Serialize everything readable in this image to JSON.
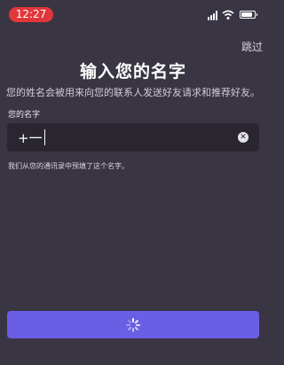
{
  "status_bar": {
    "time": "12:27"
  },
  "header": {
    "skip_label": "跳过"
  },
  "main": {
    "title": "输入您的名字",
    "subtitle": "您的姓名会被用来向您的联系人发送好友请求和推荐好友。",
    "field_label": "您的名字",
    "name_value": "+一",
    "helper_text": "我们从您的通讯录中预填了这个名字。"
  },
  "continue_button": {
    "state": "loading",
    "spinner_icon": "spinner-icon"
  },
  "colors": {
    "background": "#3a3543",
    "input_background": "#2a2630",
    "button_accent": "#6a5fe4",
    "time_pill": "#e0373a"
  }
}
